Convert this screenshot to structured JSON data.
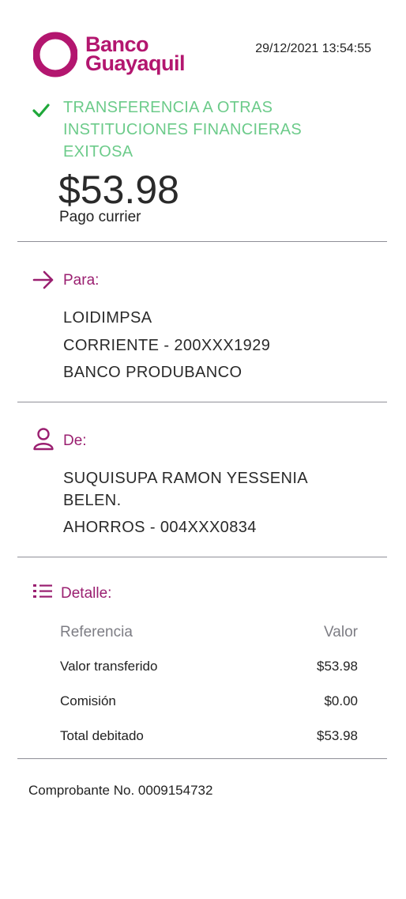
{
  "header": {
    "brand_line1": "Banco",
    "brand_line2": "Guayaquil",
    "datetime": "29/12/2021 13:54:55"
  },
  "status": {
    "title": "TRANSFERENCIA A OTRAS INSTITUCIONES FINANCIERAS EXITOSA",
    "amount": "$53.98",
    "concept": "Pago currier"
  },
  "to": {
    "label": "Para:",
    "name": "LOIDIMPSA",
    "account": "CORRIENTE - 200XXX1929",
    "bank": "BANCO PRODUBANCO"
  },
  "from": {
    "label": "De:",
    "name": "SUQUISUPA RAMON YESSENIA BELEN.",
    "account": "AHORROS - 004XXX0834"
  },
  "detail": {
    "label": "Detalle:",
    "columns": [
      "Referencia",
      "Valor"
    ],
    "rows": [
      {
        "ref": "Valor transferido",
        "value": "$53.98"
      },
      {
        "ref": "Comisión",
        "value": "$0.00"
      },
      {
        "ref": "Total debitado",
        "value": "$53.98"
      }
    ]
  },
  "receipt": "Comprobante No. 0009154732",
  "colors": {
    "brand": "#b3166f",
    "success": "#6ccb8a",
    "check": "#1fa83a",
    "section_label": "#9a1f70"
  }
}
